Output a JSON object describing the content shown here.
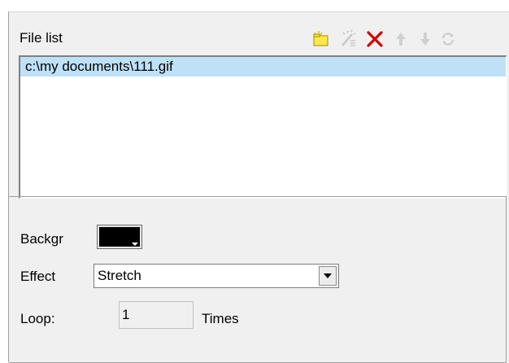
{
  "file_list": {
    "label": "File list",
    "items": [
      {
        "path": "c:\\my documents\\111.gif",
        "selected": true
      }
    ]
  },
  "toolbar": {
    "buttons": [
      {
        "name": "new-folder-icon",
        "enabled": true
      },
      {
        "name": "edit-icon",
        "enabled": false
      },
      {
        "name": "delete-icon",
        "enabled": true
      },
      {
        "name": "move-up-icon",
        "enabled": false
      },
      {
        "name": "move-down-icon",
        "enabled": false
      },
      {
        "name": "refresh-icon",
        "enabled": false
      }
    ]
  },
  "properties": {
    "background_label": "Backgr",
    "background_color": "#000000",
    "effect_label": "Effect",
    "effect_value": "Stretch",
    "loop_label": "Loop:",
    "loop_value": "1",
    "times_label": "Times"
  },
  "colors": {
    "panel": "#f0f0f0",
    "selection": "#bfe1f7",
    "delete": "#d40000"
  }
}
